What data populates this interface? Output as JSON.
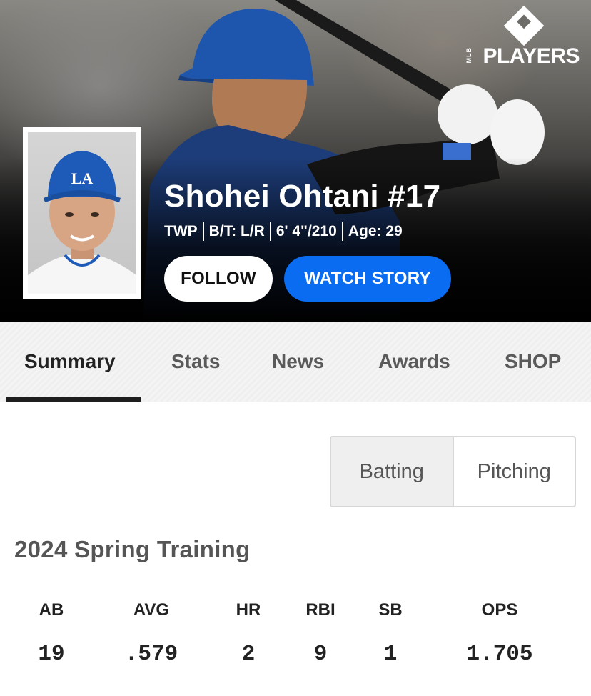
{
  "brand": {
    "wordmark": "PLAYERS",
    "sub": "MLB"
  },
  "player": {
    "name": "Shohei Ohtani #17",
    "position": "TWP",
    "bats_throws": "B/T: L/R",
    "height_weight": "6' 4\"/210",
    "age": "Age: 29",
    "cap_logo": "LA"
  },
  "actions": {
    "follow_label": "FOLLOW",
    "watch_label": "WATCH STORY"
  },
  "tabs": [
    {
      "label": "Summary",
      "active": true
    },
    {
      "label": "Stats",
      "active": false
    },
    {
      "label": "News",
      "active": false
    },
    {
      "label": "Awards",
      "active": false
    },
    {
      "label": "SHOP",
      "active": false
    }
  ],
  "toggle": {
    "batting": "Batting",
    "pitching": "Pitching",
    "selected": "Batting"
  },
  "stats": {
    "section_title": "2024 Spring Training",
    "columns": [
      {
        "label": "AB",
        "value": "19"
      },
      {
        "label": "AVG",
        "value": ".579"
      },
      {
        "label": "HR",
        "value": "2"
      },
      {
        "label": "RBI",
        "value": "9"
      },
      {
        "label": "SB",
        "value": "1"
      },
      {
        "label": "OPS",
        "value": "1.705"
      }
    ]
  },
  "colors": {
    "accent_blue": "#0a6cf0",
    "dodger_blue": "#1e5bb8",
    "text_dark": "#222222",
    "text_muted": "#555555"
  }
}
